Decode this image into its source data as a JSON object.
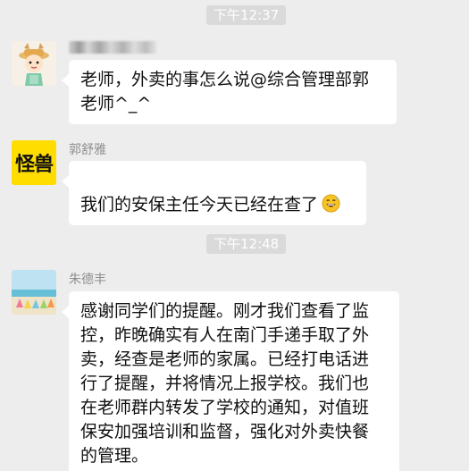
{
  "messages": [
    {
      "type": "time",
      "text": "下午12:37"
    },
    {
      "type": "message",
      "sender": "",
      "avatar": "cartoon-girl-avatar",
      "text": "老师，外卖的事怎么说@综合管理部郭\n老师^_^"
    },
    {
      "type": "message",
      "sender": "郭舒雅",
      "avatar_text": "怪兽",
      "avatar_colors": {
        "bg": "#ffdd00",
        "fg": "#111111"
      },
      "text": "我们的安保主任今天已经在查了",
      "emoji": "grinning-sweat-emoji"
    },
    {
      "type": "time",
      "text": "下午12:48"
    },
    {
      "type": "message",
      "sender": "朱德丰",
      "avatar": "beach-chairs-avatar",
      "text": "感谢同学们的提醒。刚才我们查看了监\n控，昨晚确实有人在南门手递手取了外\n卖，经查是老师的家属。已经打电话进\n行了提醒，并将情况上报学校。我们也\n在老师群内转发了学校的通知，对值班\n保安加强培训和监督，强化对外卖快餐\n的管理。"
    }
  ]
}
